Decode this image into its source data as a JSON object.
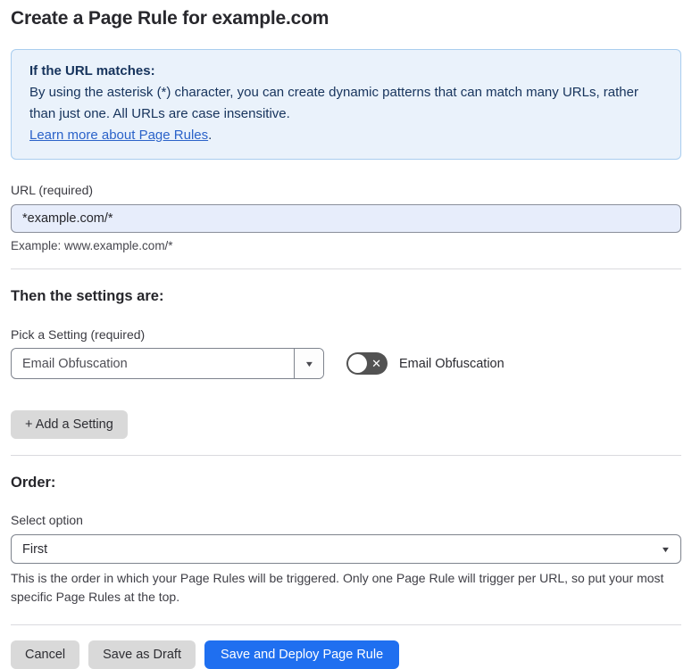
{
  "page": {
    "title": "Create a Page Rule for example.com"
  },
  "info_box": {
    "heading": "If the URL matches:",
    "body": "By using the asterisk (*) character, you can create dynamic patterns that can match many URLs, rather than just one. All URLs are case insensitive.",
    "link_label": "Learn more about Page Rules",
    "link_suffix": "."
  },
  "url_field": {
    "label": "URL (required)",
    "value": "*example.com/*",
    "helper": "Example: www.example.com/*"
  },
  "settings_section": {
    "heading": "Then the settings are:",
    "pick_label": "Pick a Setting (required)",
    "dropdown_value": "Email Obfuscation",
    "toggle_label": "Email Obfuscation",
    "toggle_state": "off",
    "add_button_label": "+ Add a Setting"
  },
  "order_section": {
    "heading": "Order:",
    "select_label": "Select option",
    "select_value": "First",
    "helper": "This is the order in which your Page Rules will be triggered. Only one Page Rule will trigger per URL, so put your most specific Page Rules at the top."
  },
  "footer": {
    "cancel_label": "Cancel",
    "save_draft_label": "Save as Draft",
    "save_deploy_label": "Save and Deploy Page Rule"
  },
  "colors": {
    "accent_blue": "#1f6ff0",
    "info_bg": "#eaf2fb",
    "info_border": "#a9cdef",
    "info_text": "#16335c",
    "link_blue": "#2a62c9",
    "input_bg": "#e7edfb",
    "toggle_off_bg": "#525252",
    "gray_button_bg": "#d9d9d9"
  },
  "icons": {
    "dropdown_arrow": "▼",
    "select_chevron": "▼",
    "toggle_x": "✕"
  }
}
